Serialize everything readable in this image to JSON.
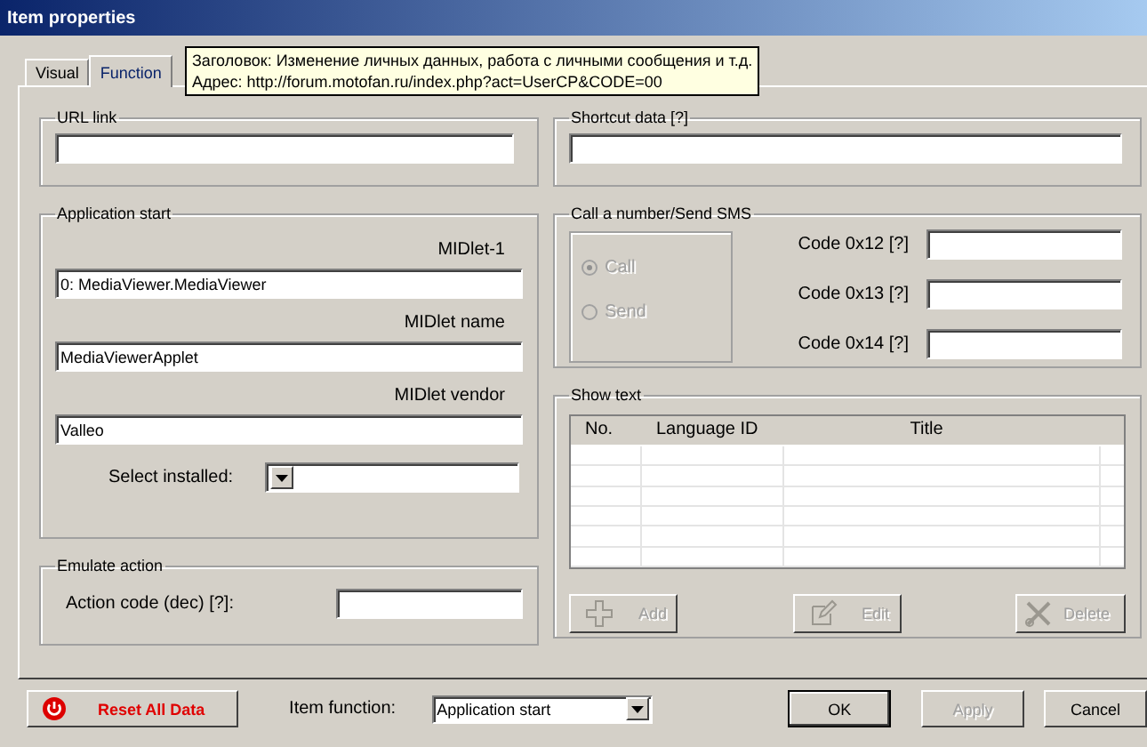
{
  "window": {
    "title": "Item properties"
  },
  "tabs": [
    {
      "label": "Visual",
      "selected": false
    },
    {
      "label": "Function",
      "selected": true
    }
  ],
  "tooltip": {
    "lines": [
      "Заголовок: Изменение личных данных, работа с личными сообщения и т.д.",
      "Адрес: http://forum.motofan.ru/index.php?act=UserCP&CODE=00"
    ]
  },
  "url_link": {
    "label": "URL link"
  },
  "shortcut_data": {
    "label": "Shortcut data [?]"
  },
  "application_start": {
    "label": "Application start",
    "fields": [
      {
        "label": "MIDlet-1",
        "value": "0: MediaViewer.MediaViewer"
      },
      {
        "label": "MIDlet name",
        "value": "MediaViewerApplet"
      },
      {
        "label": "MIDlet vendor",
        "value": "Valleo"
      }
    ],
    "select_installed": {
      "label": "Select installed:"
    }
  },
  "emulate_action": {
    "label": "Emulate action",
    "field_label": "Action code (dec) [?]:"
  },
  "call_sms": {
    "label": "Call a number/Send SMS",
    "options": [
      {
        "label": "Call",
        "selected": true,
        "disabled": true
      },
      {
        "label": "Send",
        "selected": false,
        "disabled": true
      }
    ],
    "codes": [
      {
        "label": "Code 0x12 [?]"
      },
      {
        "label": "Code 0x13 [?]"
      },
      {
        "label": "Code 0x14 [?]"
      }
    ]
  },
  "show_text": {
    "label": "Show text",
    "columns": [
      "No.",
      "Language ID",
      "Title"
    ],
    "buttons": [
      {
        "label": "Add",
        "disabled": true
      },
      {
        "label": "Edit",
        "disabled": true
      },
      {
        "label": "Delete",
        "disabled": true
      }
    ]
  },
  "bottom": {
    "reset": "Reset All Data",
    "item_function": {
      "label": "Item function:",
      "value": "Application start"
    },
    "buttons": [
      {
        "label": "OK",
        "disabled": false
      },
      {
        "label": "Apply",
        "disabled": true
      },
      {
        "label": "Cancel",
        "disabled": false
      }
    ]
  }
}
